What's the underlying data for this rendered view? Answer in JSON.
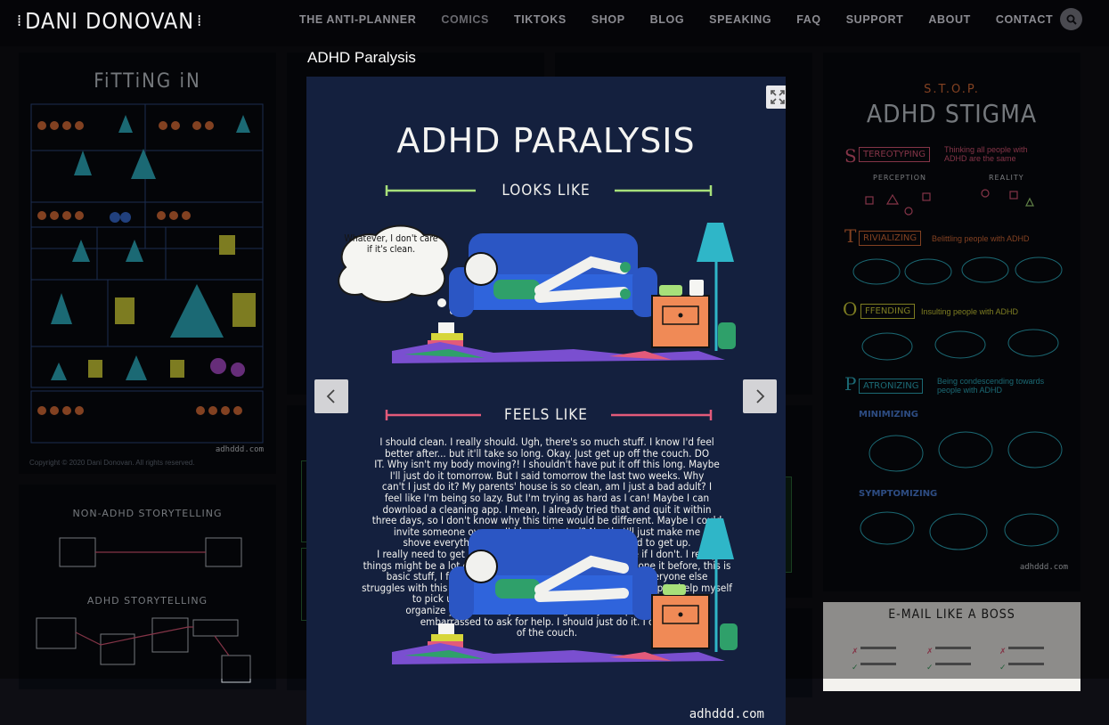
{
  "header": {
    "logo_text": "DANI DONOVAN",
    "nav": [
      {
        "label": "THE ANTI-PLANNER"
      },
      {
        "label": "COMICS"
      },
      {
        "label": "TIKTOKS"
      },
      {
        "label": "SHOP"
      },
      {
        "label": "BLOG"
      },
      {
        "label": "SPEAKING"
      },
      {
        "label": "FAQ"
      },
      {
        "label": "SUPPORT"
      },
      {
        "label": "ABOUT"
      },
      {
        "label": "CONTACT"
      }
    ],
    "search_icon": "search-icon"
  },
  "background_tiles": {
    "fitting_in": {
      "title": "FiTTiNG iN",
      "credit": "adhddd.com",
      "copyright": "Copyright © 2020 Dani Donovan. All rights reserved."
    },
    "stigma": {
      "acronym": "S.T.O.P.",
      "title": "ADHD STIGMA",
      "rows": [
        {
          "label": "TEREOTYPING",
          "letter": "S",
          "desc": "Thinking all people with ADHD are the same"
        },
        {
          "label": "RIVIALIZING",
          "letter": "T",
          "desc": "Belittling people with ADHD"
        },
        {
          "label": "FFENDING",
          "letter": "O",
          "desc": "Insulting people with ADHD"
        },
        {
          "label": "ATRONIZING",
          "letter": "P",
          "desc": "Being condescending towards people with ADHD"
        }
      ],
      "perception": "PERCEPTION",
      "reality": "REALITY",
      "minimizing": "MINIMIZING",
      "symptomizing": "SYMPTOMIZING",
      "credit": "adhddd.com"
    },
    "storytelling": {
      "title1": "NON-ADHD STORYTELLING",
      "title2": "ADHD STORYTELLING"
    },
    "email": {
      "title": "E-MAIL LIKE A BOSS"
    }
  },
  "lightbox": {
    "title": "ADHD Paralysis",
    "comic": {
      "title": "ADHD PARALYSIS",
      "looks_like": "LOOKS LIKE",
      "feels_like": "FEELS LIKE",
      "thought_bubble": "Whatever, I don't care if it's clean.",
      "feels_text_lines": [
        "I should clean. I really should. Ugh, there's so much stuff. I know I'd feel",
        "better after... but it'll take so long. Okay. Just get up off the couch. DO",
        "IT. Why isn't my body moving?! I shouldn't have put it off this long. Maybe",
        "I'll just do it tomorrow. But I said tomorrow the last two weeks. Why",
        "can't I just do it? My parents' house is so clean, am I just a bad adult? I",
        "feel like I'm being so lazy. But I'm trying as hard as I can! Maybe I can",
        "download a cleaning app. I mean, I already tried that and quit it within",
        "three days, so I don't know why this time would be different. Maybe I could",
        "invite someone over so I'd be motivated? No, that'll just make me",
        "shove everything in the closet forever. I really need to get up.",
        "I really need to get up. Nothing's ever going to get done if I don't. I really",
        "things might be a lot easier if I could just do it. I've never done it before, this is",
        "basic stuff, I feel so stupid, why is this so hard for me? Everyone else",
        "struggles with this too? I don't know. Maybe I should ask for help to help myself",
        "to pick up things. I can't even get up off the couch. I can't",
        "organize your mind if you can't organize your space, and I'm",
        "embarrassed to ask for help. I should just do it. I could",
        "of the couch."
      ],
      "watermark": "adhddd.com"
    }
  },
  "colors": {
    "page_bg": "#0e0e14",
    "header_bg": "#050508",
    "nav_text": "#8c8c92",
    "comic_bg": "#14203e",
    "looks_line": "#a7e07a",
    "feels_line": "#e35a7a"
  }
}
